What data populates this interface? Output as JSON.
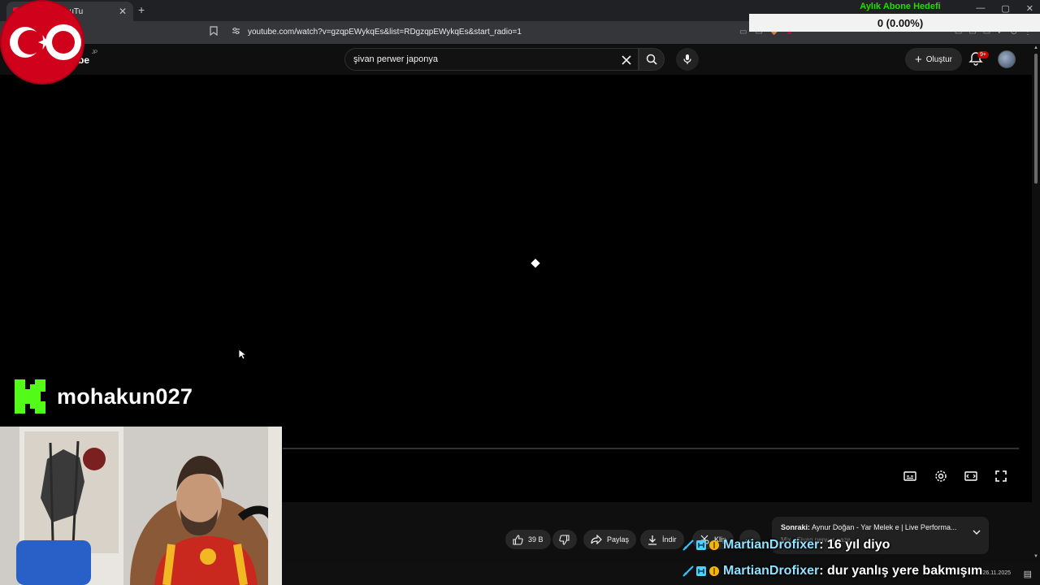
{
  "browser": {
    "tab_title": "er naze - YouTu",
    "tab_close": "✕",
    "new_tab": "+",
    "window_controls": [
      "—",
      "▢",
      "✕"
    ],
    "url": "youtube.com/watch?v=gzqpEWykqEs&list=RDgzqpEWykqEs&start_radio=1"
  },
  "youtube": {
    "logo_text": "be",
    "logo_region": "JP",
    "search_query": "şivan perwer japonya",
    "create_label": "Oluştur",
    "notification_count": "9+"
  },
  "actions": {
    "like_count": "39 B",
    "share_label": "Paylaş",
    "download_label": "İndir",
    "clip_label": "Klip"
  },
  "up_next": {
    "prefix": "Sonraki:",
    "title": "Aynur Doğan - Yar Melek e | Live Performa...",
    "subtitle": "Mix - Şivan perwer naze"
  },
  "overlay": {
    "sub_goal_title": "Aylık Abone Hedefi",
    "sub_goal_value": "0 (0.00%)",
    "sub_goal_progress": 0.0,
    "streamer_name": "mohakun027",
    "chat": [
      {
        "user": "MartianDrofixer",
        "message": "16 yıl diyo"
      },
      {
        "user": "MartianDrofixer",
        "message": "dur yanlış yere bakmışım"
      }
    ]
  },
  "taskbar": {
    "clock": "26.11.2025"
  },
  "colors": {
    "youtube_bg": "#0f0f0f",
    "video_bg": "#000000",
    "goal_green": "#22dd00",
    "kick_green": "#53fc18",
    "flag_red": "#d0021b"
  },
  "icons": [
    "search-icon",
    "microphone-icon",
    "clear-icon",
    "bell-icon",
    "plus-icon",
    "like-icon",
    "dislike-icon",
    "share-icon",
    "download-icon",
    "clip-icon",
    "subtitles-icon",
    "settings-icon",
    "theater-icon",
    "fullscreen-icon",
    "chevron-down-icon",
    "bookmark-icon",
    "cursor-icon",
    "kick-logo-icon"
  ]
}
